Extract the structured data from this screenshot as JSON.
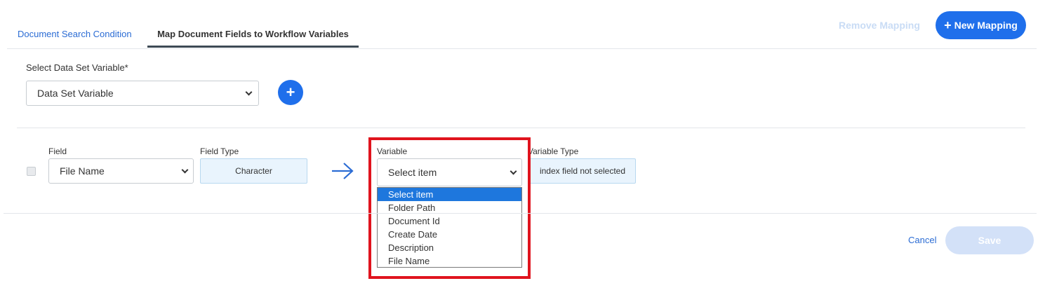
{
  "tabs": [
    {
      "label": "Document Search Condition",
      "active": false
    },
    {
      "label": "Map Document Fields to Workflow Variables",
      "active": true
    }
  ],
  "header_actions": {
    "remove_label": "Remove Mapping",
    "new_label": "New Mapping",
    "new_icon": "+"
  },
  "dataset": {
    "label": "Select Data Set Variable*",
    "selected": "Data Set Variable",
    "add_icon": "+"
  },
  "mapping_row": {
    "field_label": "Field",
    "field_value": "File Name",
    "field_type_label": "Field Type",
    "field_type_value": "Character",
    "variable_label": "Variable",
    "variable_value": "Select item",
    "variable_type_label": "Variable Type",
    "variable_type_value": "index field not selected",
    "variable_options": [
      "Select item",
      "Folder Path",
      "Document Id",
      "Create Date",
      "Description",
      "File Name"
    ],
    "highlighted_option": "Select item"
  },
  "footer": {
    "cancel_label": "Cancel",
    "save_label": "Save"
  },
  "colors": {
    "accent": "#1f6feb",
    "link": "#2b6cd4",
    "highlight_box": "#e0141e",
    "disabled_text": "#c9dcf5"
  }
}
